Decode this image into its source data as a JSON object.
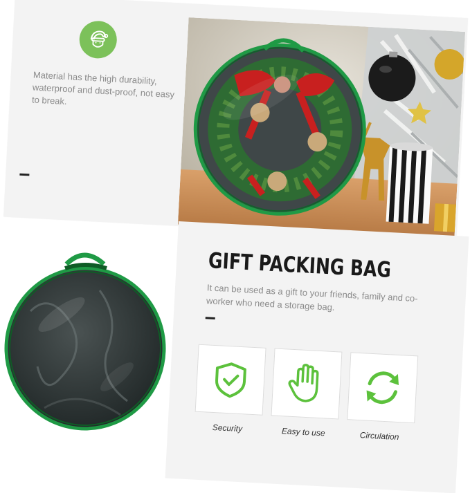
{
  "top_panel": {
    "icon": "santa-icon",
    "description": "Material has the high durability, waterproof and dust-proof, not easy to break."
  },
  "bottom_panel": {
    "title": "GIFT PACKING BAG",
    "subtitle": "It can be used as a gift to your friends, family and co-worker who need a storage bag."
  },
  "features": [
    {
      "icon": "shield-check-icon",
      "label": "Security"
    },
    {
      "icon": "hand-icon",
      "label": "Easy to use"
    },
    {
      "icon": "circulation-icon",
      "label": "Circulation"
    }
  ],
  "colors": {
    "accent_green": "#7cc15a",
    "icon_green": "#5cc13c",
    "bag_trim": "#1f9a45"
  }
}
